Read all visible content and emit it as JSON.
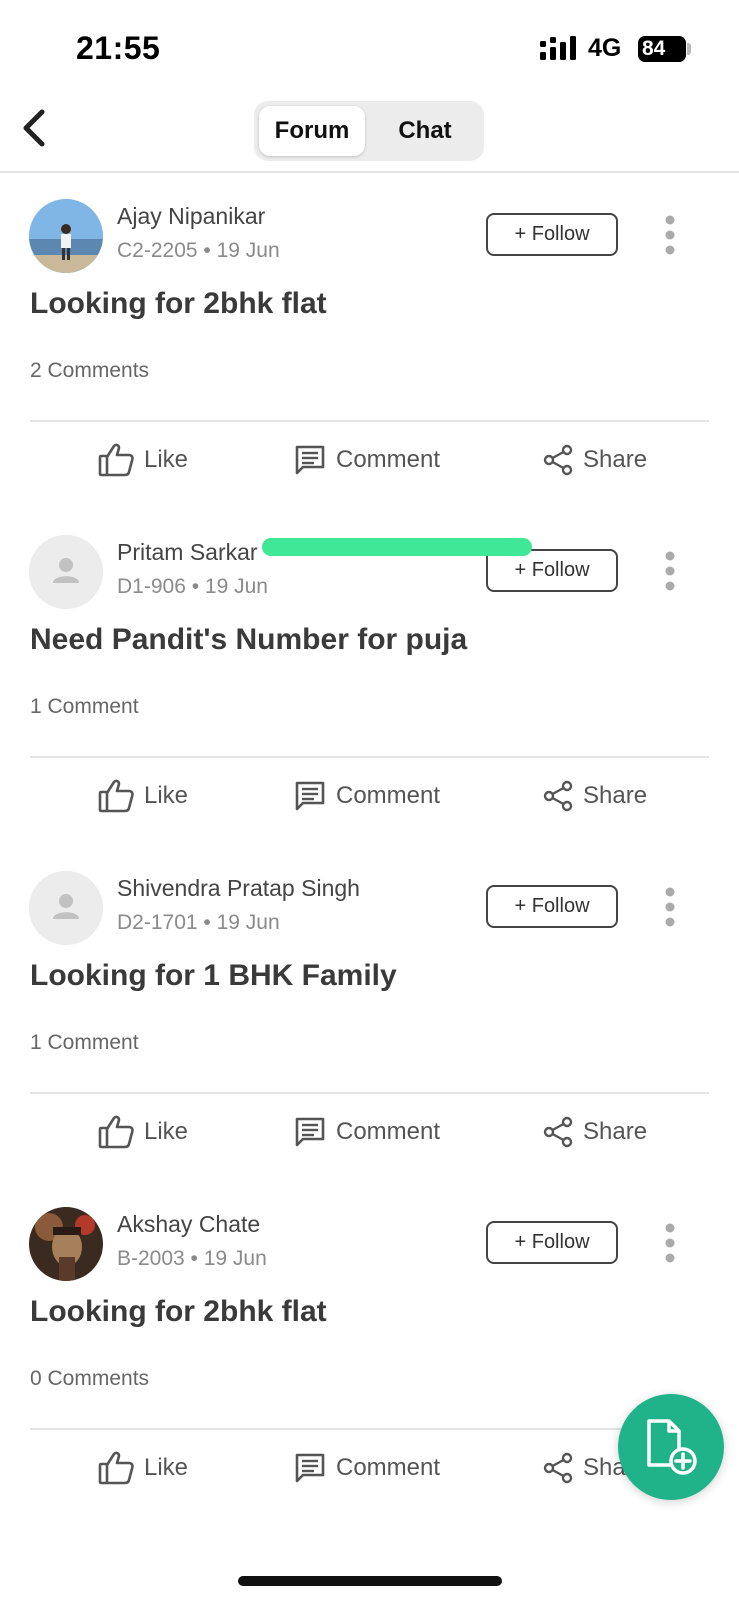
{
  "status_bar": {
    "time": "21:55",
    "network": "4G",
    "battery": "84"
  },
  "header": {
    "back_icon": "chevron-left-icon",
    "tabs": [
      {
        "label": "Forum",
        "active": true
      },
      {
        "label": "Chat",
        "active": false
      }
    ]
  },
  "posts": [
    {
      "author": "Ajay Nipanikar",
      "unit": "C2-2205",
      "date": "19 Jun",
      "meta": "C2-2205 • 19 Jun",
      "title": "Looking for 2bhk flat",
      "comments": "2 Comments",
      "avatar": "photo"
    },
    {
      "author": "Pritam Sarkar",
      "unit": "D1-906",
      "date": "19 Jun",
      "meta": "D1-906 • 19 Jun",
      "title": "Need Pandit's Number for puja",
      "comments": "1 Comment",
      "avatar": "placeholder"
    },
    {
      "author": "Shivendra Pratap Singh",
      "unit": "D2-1701",
      "date": "19 Jun",
      "meta": "D2-1701 • 19 Jun",
      "title": "Looking for 1 BHK Family",
      "comments": "1 Comment",
      "avatar": "placeholder"
    },
    {
      "author": "Akshay Chate",
      "unit": "B-2003",
      "date": "19 Jun",
      "meta": "B-2003 • 19 Jun",
      "title": "Looking for 2bhk flat",
      "comments": "0 Comments",
      "avatar": "photo"
    }
  ],
  "actions": {
    "follow": "+ Follow",
    "like": "Like",
    "comment": "Comment",
    "share": "Share"
  },
  "colors": {
    "accent": "#20b389",
    "highlight": "#3ee896"
  },
  "fab": {
    "icon": "new-document-plus-icon"
  }
}
